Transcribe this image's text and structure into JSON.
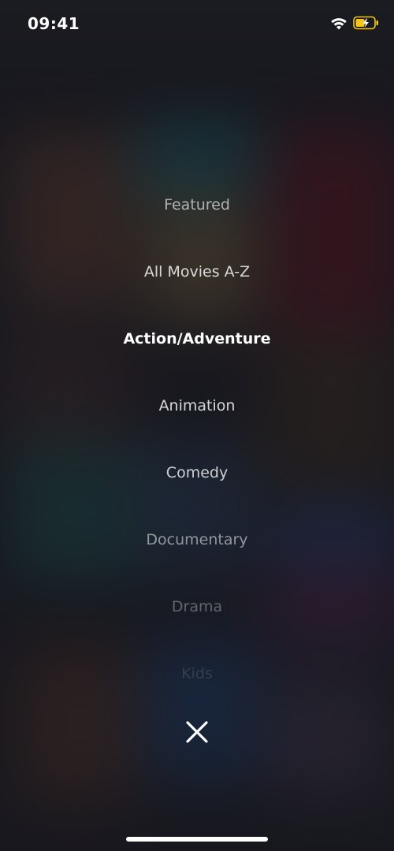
{
  "status_bar": {
    "time": "09:41",
    "wifi_icon": "wifi-icon",
    "battery_icon": "battery-charging-icon",
    "battery_color": "#f5c518"
  },
  "menu": {
    "items": [
      {
        "label": "Featured",
        "selected": false
      },
      {
        "label": "All Movies A-Z",
        "selected": false
      },
      {
        "label": "Action/Adventure",
        "selected": true
      },
      {
        "label": "Animation",
        "selected": false
      },
      {
        "label": "Comedy",
        "selected": false
      },
      {
        "label": "Documentary",
        "selected": false
      },
      {
        "label": "Drama",
        "selected": false
      },
      {
        "label": "Kids",
        "selected": false
      }
    ]
  },
  "close": {
    "icon": "close-icon"
  },
  "colors": {
    "background": "#1b1c22",
    "text": "#ffffff"
  }
}
